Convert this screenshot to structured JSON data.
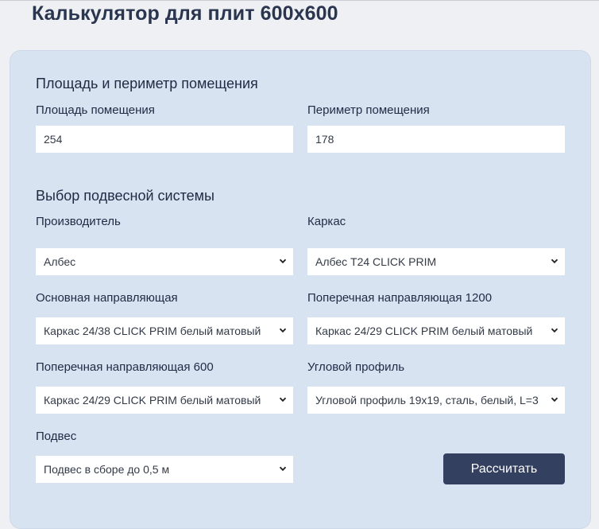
{
  "page": {
    "title": "Калькулятор для плит 600х600"
  },
  "area_section": {
    "title": "Площадь и периметр помещения",
    "area_label": "Площадь помещения",
    "area_value": "254",
    "perimeter_label": "Периметр помещения",
    "perimeter_value": "178"
  },
  "system_section": {
    "title": "Выбор подвесной системы",
    "manufacturer": {
      "label": "Производитель",
      "value": "Албес"
    },
    "frame": {
      "label": "Каркас",
      "value": "Албес T24 CLICK PRIM"
    },
    "main_runner": {
      "label": "Основная направляющая",
      "value": "Каркас 24/38 CLICK PRIM белый матовый"
    },
    "cross_1200": {
      "label": "Поперечная направляющая 1200",
      "value": "Каркас 24/29 CLICK PRIM белый матовый"
    },
    "cross_600": {
      "label": "Поперечная направляющая 600",
      "value": "Каркас 24/29 CLICK PRIM белый матовый"
    },
    "corner_profile": {
      "label": "Угловой профиль",
      "value": "Угловой профиль 19x19, сталь, белый, L=3"
    },
    "hanger": {
      "label": "Подвес",
      "value": "Подвес в сборе до 0,5 м"
    }
  },
  "actions": {
    "calculate_label": "Рассчитать"
  },
  "colors": {
    "background": "#eef0f3",
    "panel": "#d7e3f1",
    "button": "#334060",
    "text": "#1f2b45"
  }
}
